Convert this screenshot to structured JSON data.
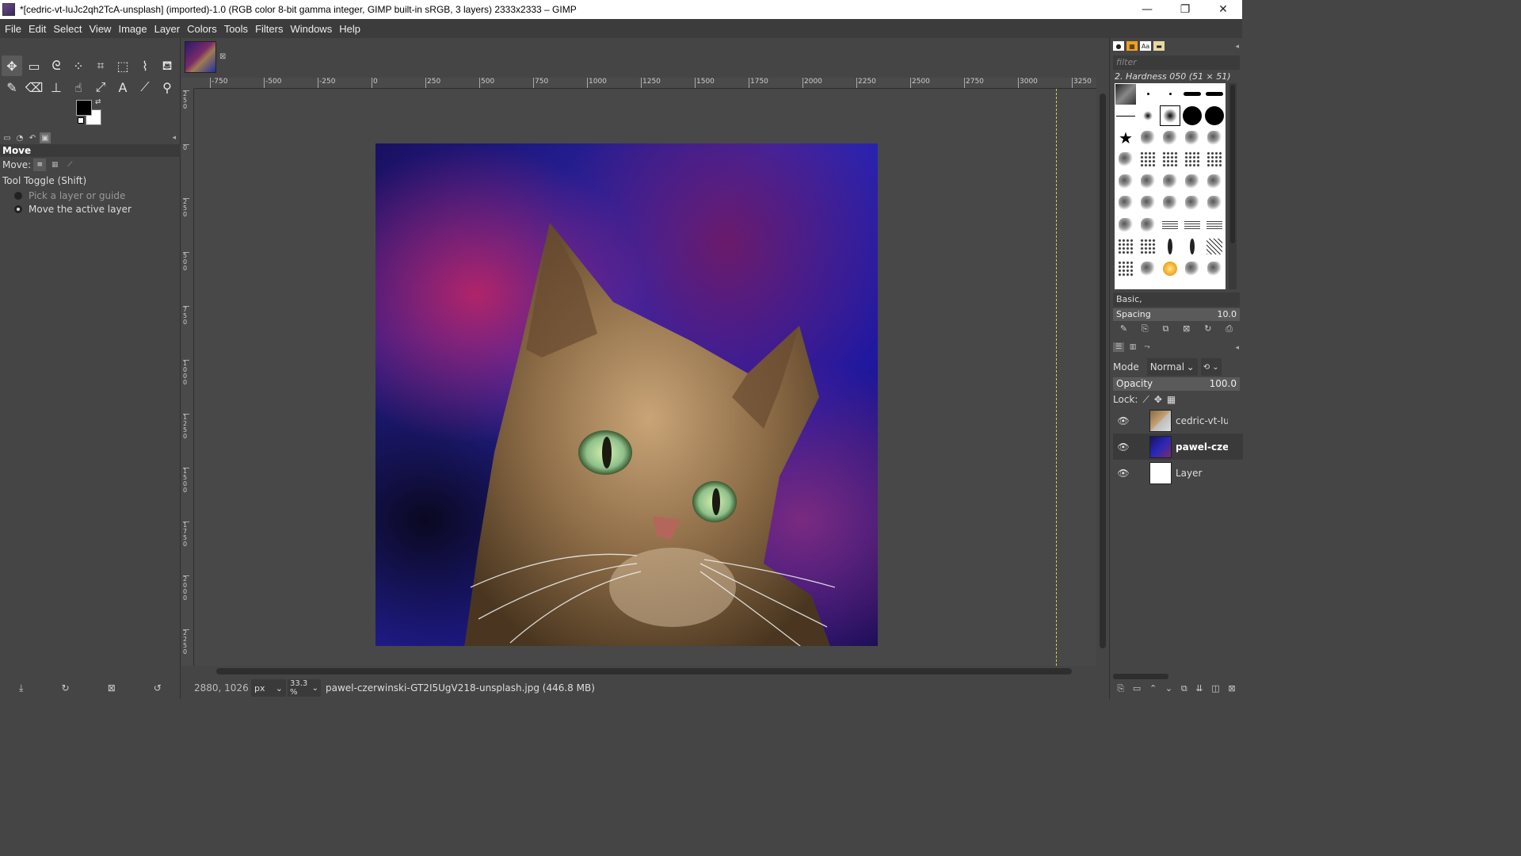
{
  "window": {
    "title": "*[cedric-vt-IuJc2qh2TcA-unsplash] (imported)-1.0 (RGB color 8-bit gamma integer, GIMP built-in sRGB, 3 layers) 2333x2333 – GIMP",
    "minimize": "—",
    "maximize": "❐",
    "close": "✕"
  },
  "menu": [
    "File",
    "Edit",
    "Select",
    "View",
    "Image",
    "Layer",
    "Colors",
    "Tools",
    "Filters",
    "Windows",
    "Help"
  ],
  "tools": [
    {
      "name": "move-tool-icon",
      "glyph": "✥",
      "active": true
    },
    {
      "name": "rect-select-icon",
      "glyph": "▭"
    },
    {
      "name": "free-select-icon",
      "glyph": "ᘓ"
    },
    {
      "name": "fuzzy-select-icon",
      "glyph": "⁘"
    },
    {
      "name": "crop-icon",
      "glyph": "⌗"
    },
    {
      "name": "unified-transform-icon",
      "glyph": "⬚"
    },
    {
      "name": "warp-transform-icon",
      "glyph": "⌇"
    },
    {
      "name": "bucket-fill-icon",
      "glyph": "⛾"
    },
    {
      "name": "paintbrush-icon",
      "glyph": "✎"
    },
    {
      "name": "eraser-icon",
      "glyph": "⌫"
    },
    {
      "name": "clone-icon",
      "glyph": "⊥"
    },
    {
      "name": "smudge-icon",
      "glyph": "☝"
    },
    {
      "name": "paths-icon",
      "glyph": "⤢"
    },
    {
      "name": "text-icon",
      "glyph": "A"
    },
    {
      "name": "color-picker-icon",
      "glyph": "⟋"
    },
    {
      "name": "zoom-icon",
      "glyph": "⚲"
    }
  ],
  "tool_options": {
    "title": "Move",
    "move_label": "Move:",
    "toggle_label": "Tool Toggle  (Shift)",
    "option_pick": "Pick a layer or guide",
    "option_move": "Move the active layer"
  },
  "ruler": {
    "h_ticks": [
      "-750",
      "-500",
      "-250",
      "0",
      "250",
      "500",
      "750",
      "1000",
      "1250",
      "1500",
      "1750",
      "2000",
      "2250",
      "2500",
      "2750",
      "3000",
      "3250"
    ],
    "v_ticks": [
      "250",
      "0",
      "250",
      "500",
      "750",
      "1000",
      "1250",
      "1500",
      "1750",
      "2000",
      "2250",
      "2500"
    ]
  },
  "status": {
    "coords": "2880, 1026",
    "unit": "px",
    "zoom": "33.3 %",
    "message": "pawel-czerwinski-GT2I5UgV218-unsplash.jpg (446.8 MB)"
  },
  "brushes": {
    "filter_placeholder": "filter",
    "selected_name": "2. Hardness 050 (51 × 51)",
    "tag_select": "Basic,",
    "spacing_label": "Spacing",
    "spacing_value": "10.0"
  },
  "layers_panel": {
    "mode_label": "Mode",
    "mode_value": "Normal",
    "opacity_label": "Opacity",
    "opacity_value": "100.0",
    "lock_label": "Lock:",
    "layers": [
      {
        "name": "cedric-vt-IuJc",
        "active": false,
        "thumb": "cat"
      },
      {
        "name": "pawel-czerv",
        "active": true,
        "thumb": "abstract"
      },
      {
        "name": "Layer",
        "active": false,
        "thumb": "white"
      }
    ]
  }
}
